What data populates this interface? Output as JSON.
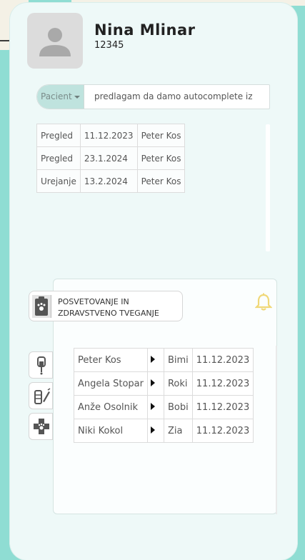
{
  "patient": {
    "name": "Nina Mlinar",
    "id": "12345"
  },
  "search": {
    "filter_label": "Pacient",
    "query": "predlagam da damo autocomplete iz"
  },
  "visits": [
    {
      "type": "Pregled",
      "date": "11.12.2023",
      "doctor": "Peter Kos"
    },
    {
      "type": "Pregled",
      "date": "23.1.2024",
      "doctor": "Peter Kos"
    },
    {
      "type": "Urejanje",
      "date": "13.2.2024",
      "doctor": "Peter Kos"
    }
  ],
  "counseling": {
    "label_line1": "POSVETOVANJE IN",
    "label_line2": "ZDRAVSTVENO TVEGANJE"
  },
  "owners": [
    {
      "name": "Peter Kos",
      "pet": "Bimi",
      "date": "11.12.2023"
    },
    {
      "name": "Angela Stopar",
      "pet": "Roki",
      "date": "11.12.2023"
    },
    {
      "name": "Anže Osolnik",
      "pet": "Bobi",
      "date": "11.12.2023"
    },
    {
      "name": "Niki Kokol",
      "pet": "Zia",
      "date": "11.12.2023"
    }
  ],
  "icons": {
    "avatar": "user-silhouette-icon",
    "notification": "bell-icon",
    "side": [
      "iv-drip-icon",
      "syringe-bandage-icon",
      "medical-cross-paw-icon"
    ],
    "counseling": "clipboard-paw-icon"
  },
  "colors": {
    "background": "#8fddd3",
    "card": "#eef9f8",
    "bell": "#f0d878",
    "filter_button": "#bfe3de"
  }
}
